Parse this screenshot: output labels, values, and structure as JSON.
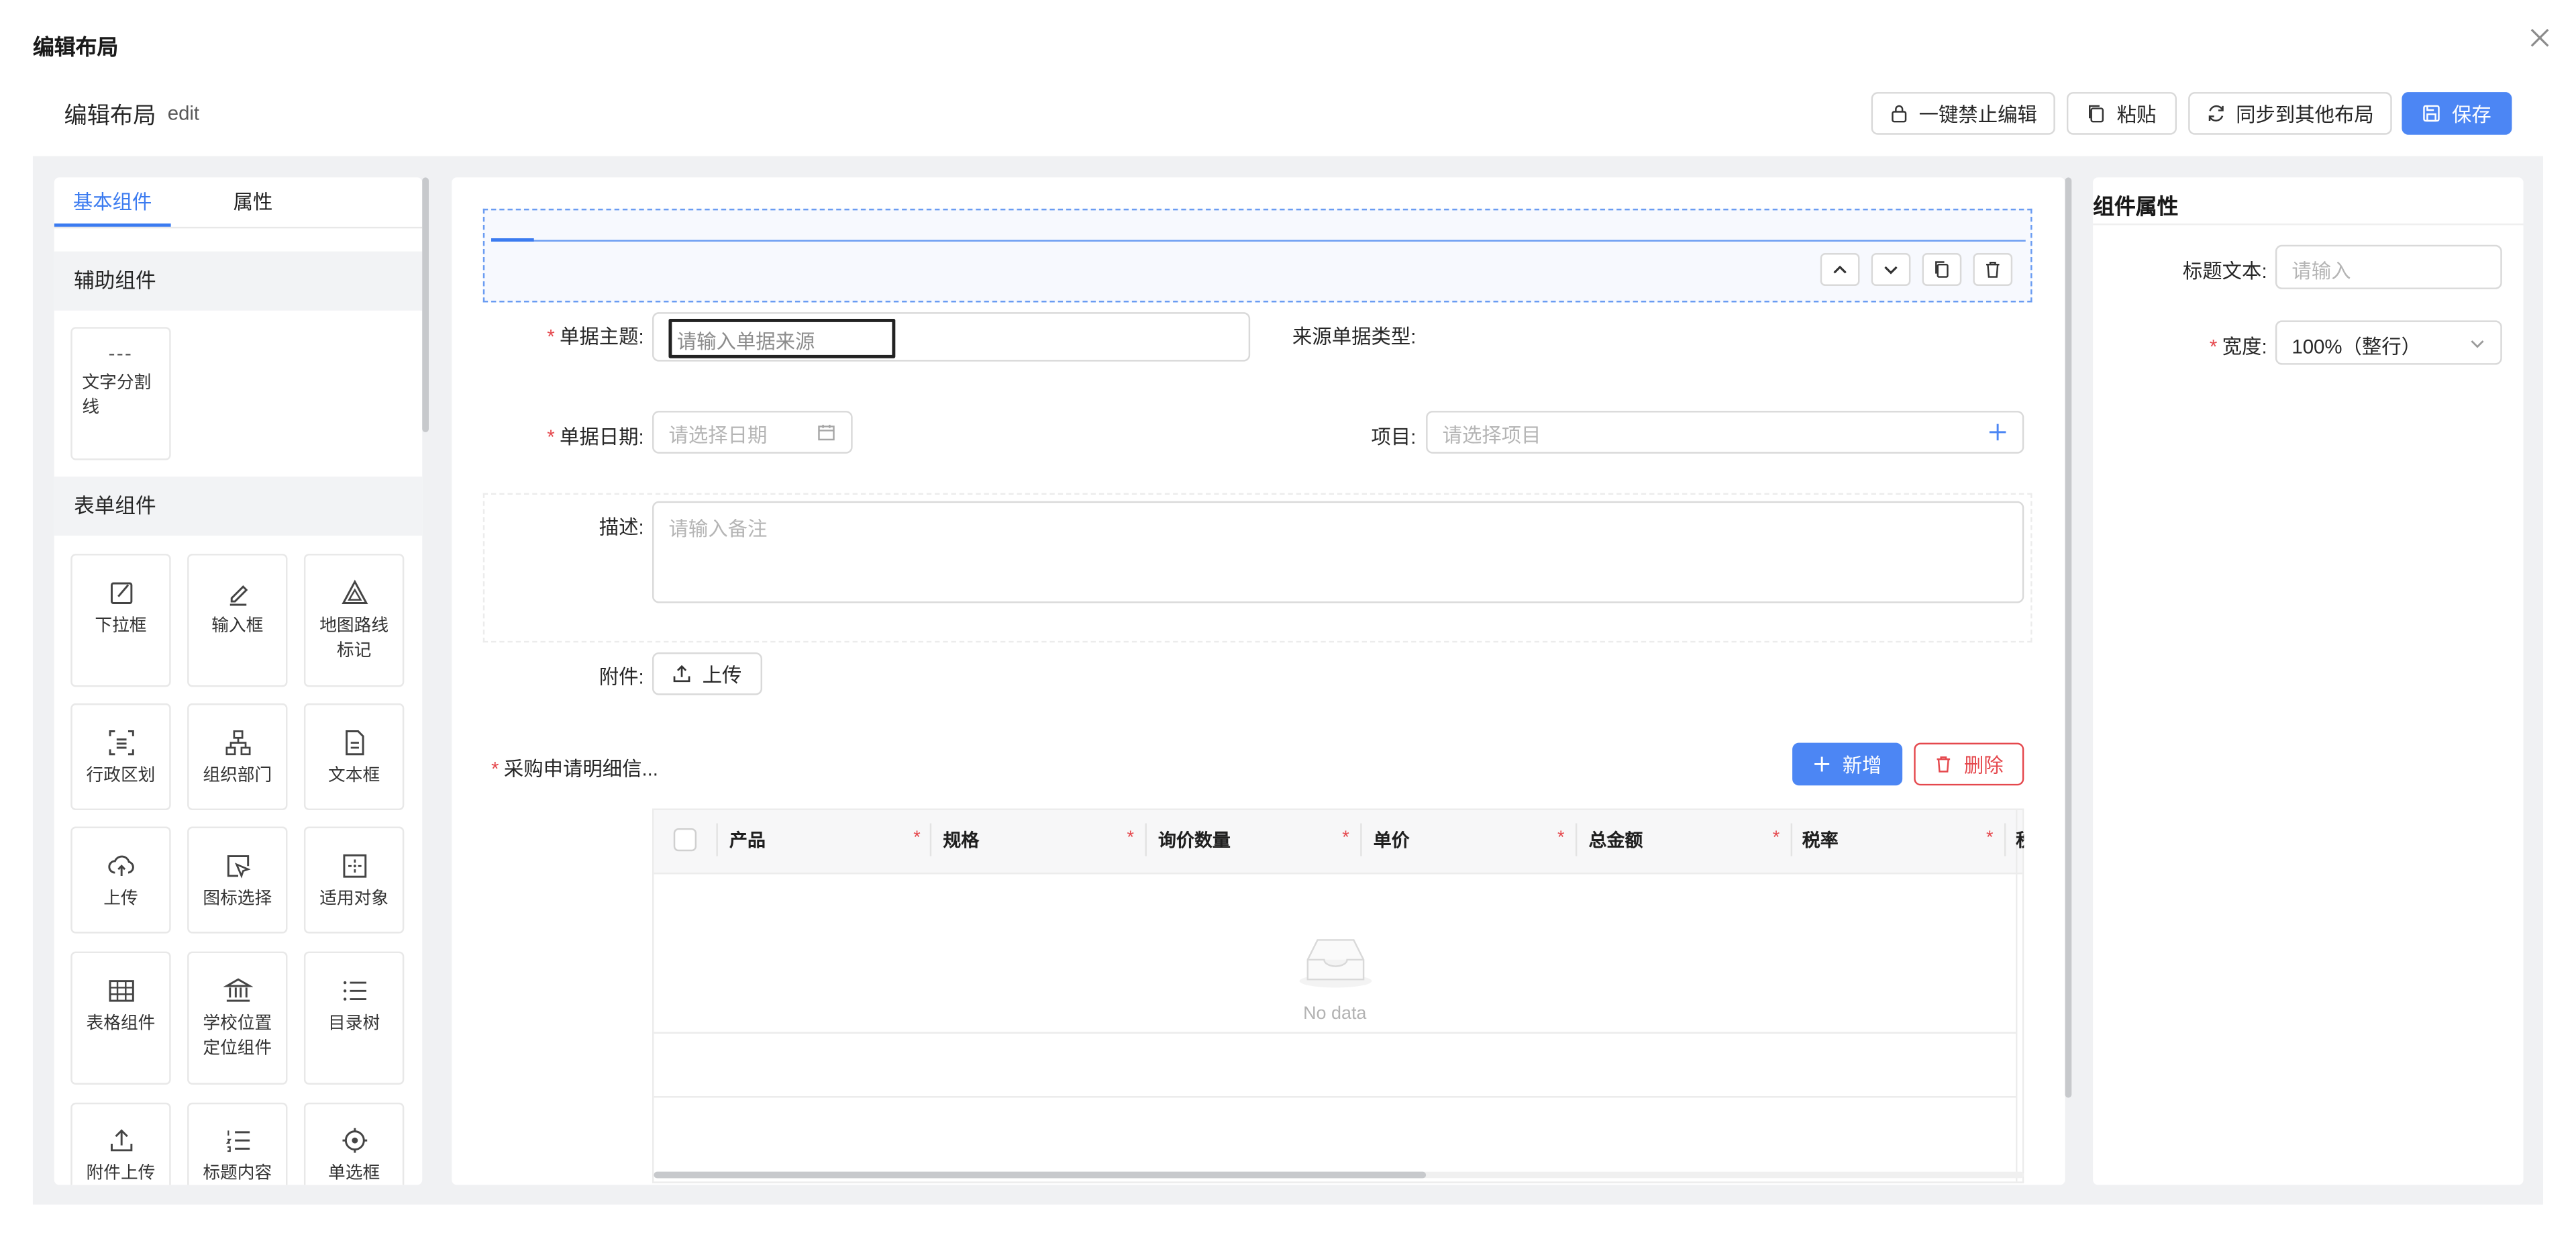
{
  "dialog": {
    "title": "编辑布局"
  },
  "header": {
    "title": "编辑布局",
    "tag": "edit"
  },
  "toolbar": {
    "lock_label": "一键禁止编辑",
    "paste_label": "粘贴",
    "sync_label": "同步到其他布局",
    "save_label": "保存"
  },
  "left": {
    "tabs": [
      "基本组件",
      "属性"
    ],
    "groups": {
      "aux": "辅助组件",
      "form": "表单组件"
    },
    "aux_items": [
      {
        "label1": "文字分割",
        "label2": "线"
      }
    ],
    "form_items": [
      {
        "label1": "下拉框",
        "label2": "",
        "icon": "edit-square-icon"
      },
      {
        "label1": "输入框",
        "label2": "",
        "icon": "pen-icon"
      },
      {
        "label1": "地图路线",
        "label2": "标记",
        "icon": "map-route-icon"
      },
      {
        "label1": "行政区划",
        "label2": "",
        "icon": "region-icon"
      },
      {
        "label1": "组织部门",
        "label2": "",
        "icon": "org-chart-icon"
      },
      {
        "label1": "文本框",
        "label2": "",
        "icon": "document-icon"
      },
      {
        "label1": "上传",
        "label2": "",
        "icon": "cloud-upload-icon"
      },
      {
        "label1": "图标选择",
        "label2": "",
        "icon": "select-cursor-icon"
      },
      {
        "label1": "适用对象",
        "label2": "",
        "icon": "target-box-icon"
      },
      {
        "label1": "表格组件",
        "label2": "",
        "icon": "table-icon"
      },
      {
        "label1": "学校位置",
        "label2": "定位组件",
        "icon": "bank-icon"
      },
      {
        "label1": "目录树",
        "label2": "",
        "icon": "list-icon"
      },
      {
        "label1": "附件上传",
        "label2": "",
        "icon": "upload-icon"
      },
      {
        "label1": "标题内容",
        "label2": "",
        "icon": "ordered-list-icon"
      },
      {
        "label1": "单选框",
        "label2": "",
        "icon": "aim-icon"
      }
    ]
  },
  "form": {
    "subject_label": "单据主题",
    "subject_placeholder": "请输入单据来源",
    "source_type_label": "来源单据类型",
    "date_label": "单据日期",
    "date_placeholder": "请选择日期",
    "project_label": "项目",
    "project_placeholder": "请选择项目",
    "desc_label": "描述",
    "desc_placeholder": "请输入备注",
    "attach_label": "附件",
    "upload_label": "上传",
    "colon": ":"
  },
  "detail": {
    "title": "采购申请明细信...",
    "add_label": "新增",
    "delete_label": "删除",
    "columns": [
      "产品",
      "规格",
      "询价数量",
      "单价",
      "总金额",
      "税率",
      "税"
    ],
    "empty_text": "No data"
  },
  "right": {
    "title": "组件属性",
    "title_text_label": "标题文本",
    "title_text_placeholder": "请输入",
    "width_label": "宽度",
    "width_value": "100%（整行）"
  },
  "colors": {
    "primary": "#4c86f4",
    "danger": "#e5484d",
    "workspace_bg": "#f0f1f3"
  }
}
